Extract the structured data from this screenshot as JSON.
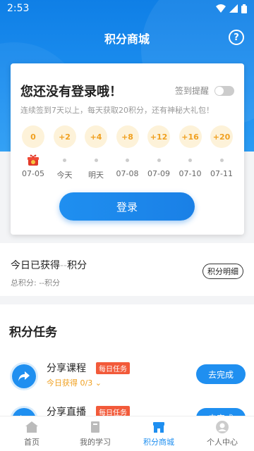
{
  "status_bar": {
    "time": "2:53"
  },
  "header": {
    "title": "积分商城",
    "help_icon": "question-circle-icon"
  },
  "signin_card": {
    "title": "您还没有登录哦！",
    "reminder_label": "签到提醒",
    "reminder_on": false,
    "subtitle": "连续签到7天以上，每天获取20积分，还有神秘大礼包！",
    "days": [
      {
        "points": "0",
        "label": "07-05",
        "marker": "gift"
      },
      {
        "points": "+2",
        "label": "今天",
        "marker": "dot"
      },
      {
        "points": "+4",
        "label": "明天",
        "marker": "dot"
      },
      {
        "points": "+8",
        "label": "07-08",
        "marker": "dot"
      },
      {
        "points": "+12",
        "label": "07-09",
        "marker": "dot"
      },
      {
        "points": "+16",
        "label": "07-10",
        "marker": "dot"
      },
      {
        "points": "+20",
        "label": "07-11",
        "marker": "dot"
      }
    ],
    "login_button": "登录"
  },
  "points": {
    "today_prefix": "今日已获得",
    "today_value": "--",
    "today_suffix": "积分",
    "total": "总积分: --积分",
    "detail_button": "积分明细"
  },
  "tasks": {
    "title": "积分任务",
    "items": [
      {
        "name": "分享课程",
        "badge": "每日任务",
        "progress": "今日获得 0/3",
        "action": "去完成"
      },
      {
        "name": "分享直播",
        "badge": "每日任务",
        "progress": "",
        "action": "去完成"
      }
    ]
  },
  "tabbar": {
    "items": [
      {
        "label": "首页",
        "icon": "home-icon",
        "active": false
      },
      {
        "label": "我的学习",
        "icon": "book-icon",
        "active": false
      },
      {
        "label": "积分商城",
        "icon": "store-icon",
        "active": true
      },
      {
        "label": "个人中心",
        "icon": "user-icon",
        "active": false
      }
    ]
  },
  "colors": {
    "primary": "#1f8ff0",
    "accent": "#f0a020",
    "badge": "#f25a3a"
  }
}
